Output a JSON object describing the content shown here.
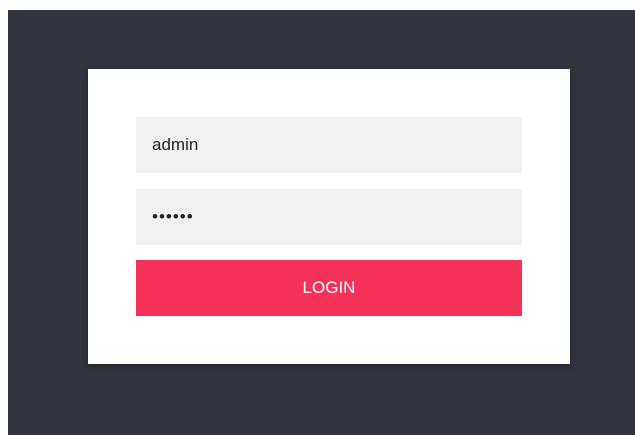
{
  "login_form": {
    "username": {
      "value": "admin"
    },
    "password": {
      "value": "••••••"
    },
    "submit_label": "LOGIN"
  },
  "colors": {
    "background": "#32343f",
    "card": "#ffffff",
    "field_background": "#f1f1f1",
    "button": "#f43157",
    "button_text": "#ffffff"
  }
}
